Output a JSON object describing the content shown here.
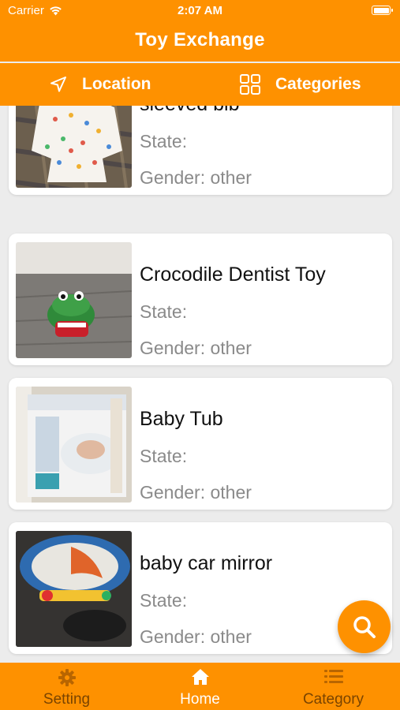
{
  "status_bar": {
    "carrier": "Carrier",
    "time": "2:07 AM"
  },
  "app": {
    "title": "Toy Exchange",
    "accent_color": "#fe9100"
  },
  "filters": {
    "location": {
      "label": "Location",
      "icon": "location-arrow-icon"
    },
    "categories": {
      "label": "Categories",
      "icon": "grid-icon"
    }
  },
  "items": [
    {
      "title": "sleeved bib",
      "state": "State:",
      "gender": "Gender: other"
    },
    {
      "title": "Crocodile Dentist Toy",
      "state": "State:",
      "gender": "Gender: other"
    },
    {
      "title": "Baby Tub",
      "state": "State:",
      "gender": "Gender: other"
    },
    {
      "title": "baby car mirror",
      "state": "State:",
      "gender": "Gender: other"
    }
  ],
  "fab": {
    "icon": "search-icon"
  },
  "tabs": [
    {
      "label": "Setting",
      "icon": "gear-icon",
      "active": false
    },
    {
      "label": "Home",
      "icon": "home-icon",
      "active": true
    },
    {
      "label": "Category",
      "icon": "list-icon",
      "active": false
    }
  ]
}
